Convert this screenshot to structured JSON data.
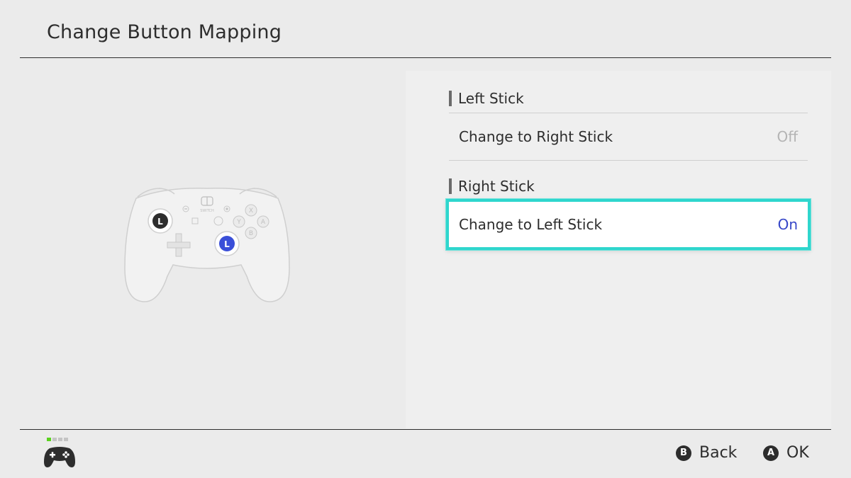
{
  "header": {
    "title": "Change Button Mapping"
  },
  "sections": [
    {
      "header": "Left Stick",
      "option": {
        "label": "Change to Right Stick",
        "value": "Off",
        "selected": false
      }
    },
    {
      "header": "Right Stick",
      "option": {
        "label": "Change to Left Stick",
        "value": "On",
        "selected": true
      }
    }
  ],
  "controller": {
    "left_stick_letter": "L",
    "right_stick_letter": "L",
    "face_buttons": [
      "X",
      "Y",
      "A",
      "B"
    ],
    "logo_text": "SWITCH"
  },
  "footer": {
    "icon": "controller-icon",
    "hints": [
      {
        "glyph": "B",
        "label": "Back"
      },
      {
        "glyph": "A",
        "label": "OK"
      }
    ]
  },
  "colors": {
    "accent": "#2fd6cd",
    "value_on": "#3747c8",
    "value_off": "#b4b4b4",
    "remapped_stick": "#3a4fd8",
    "player_led": "#5ad21e"
  }
}
